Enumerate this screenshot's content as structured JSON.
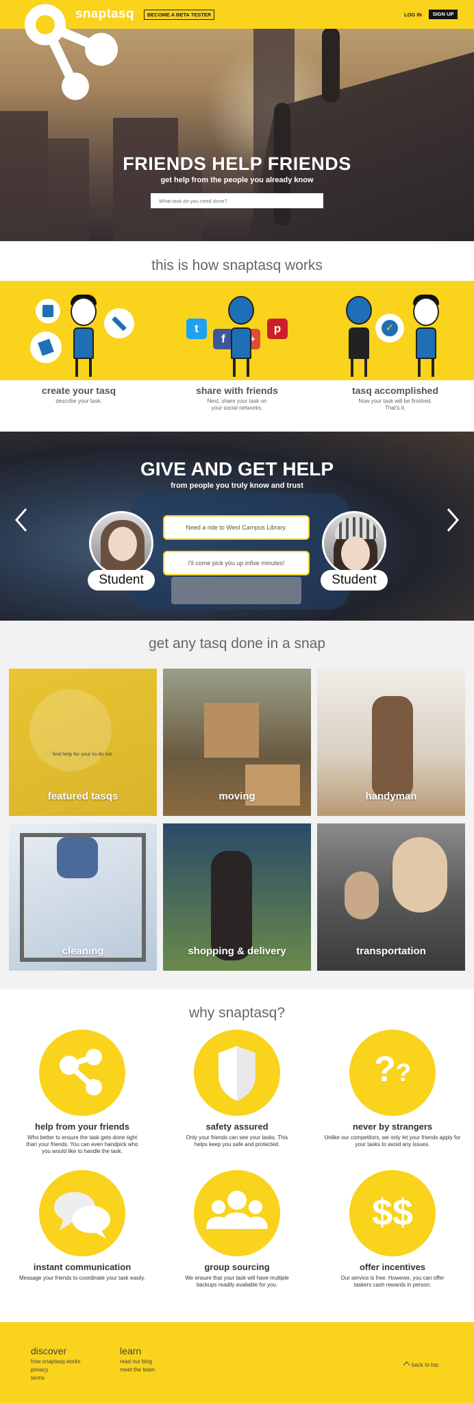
{
  "header": {
    "brand": "snaptasq",
    "beta_label": "BECOME A BETA TESTER",
    "login_label": "LOG IN",
    "signup_label": "SIGN UP"
  },
  "hero": {
    "title": "FRIENDS HELP FRIENDS",
    "subtitle": "get help from the people you already know",
    "search_placeholder": "What task do you need done?"
  },
  "how": {
    "title": "this is how snaptasq works",
    "steps": [
      {
        "title": "create your tasq",
        "desc": "describe your task."
      },
      {
        "title": "share with friends",
        "desc": "Next, share your task on your social networks."
      },
      {
        "title": "tasq accomplished",
        "desc": "Now your task will be finished. That's it."
      }
    ]
  },
  "give": {
    "title": "GIVE AND GET HELP",
    "subtitle": "from people you truly know and trust",
    "message_1": "Need a ride to West Campus Library.",
    "message_2": "I'll come pick you up infive minutes!",
    "left_tag": "Student",
    "right_tag": "Student",
    "prev_icon": "chevron-left-icon",
    "next_icon": "chevron-right-icon"
  },
  "snap": {
    "title": "get any tasq done in a snap",
    "tiles": [
      {
        "label": "featured tasqs",
        "text": "find help for your to-do list."
      },
      {
        "label": "moving"
      },
      {
        "label": "handyman"
      },
      {
        "label": "cleaning"
      },
      {
        "label": "shopping & delivery"
      },
      {
        "label": "transportation"
      }
    ]
  },
  "why": {
    "title": "why snaptasq?",
    "features": [
      {
        "title": "help from your friends",
        "desc": "Who better to ensure the task gets done right than your friends. You can even handpick who you would like to handle the task.",
        "icon": "share-icon"
      },
      {
        "title": "safety assured",
        "desc": "Only your friends can see your tasks. This helps keep you safe and protected.",
        "icon": "shield-icon"
      },
      {
        "title": "never by strangers",
        "desc": "Unlike our competitors, we only let your friends apply for your tasks to avoid any issues.",
        "icon": "question-icon"
      },
      {
        "title": "instant communication",
        "desc": "Message your friends to coordinate your task easily.",
        "icon": "chat-icon"
      },
      {
        "title": "group sourcing",
        "desc": "We ensure that your task will have multiple backups readily available for you.",
        "icon": "group-icon"
      },
      {
        "title": "offer incentives",
        "desc": "Our service is free. However, you can offer taskers cash rewards in person.",
        "icon": "dollar-icon"
      }
    ]
  },
  "footer": {
    "discover_title": "discover",
    "discover_links": [
      "how snaptasq works",
      "privacy",
      "terms"
    ],
    "learn_title": "learn",
    "learn_links": [
      "read our blog",
      "meet the team"
    ],
    "back_to_top": "back to top"
  },
  "colors": {
    "brand_yellow": "#f9d31c",
    "social_twitter": "#1da1f2",
    "social_facebook": "#3b5998",
    "social_google": "#dd4b39",
    "social_pinterest": "#cb2027"
  }
}
